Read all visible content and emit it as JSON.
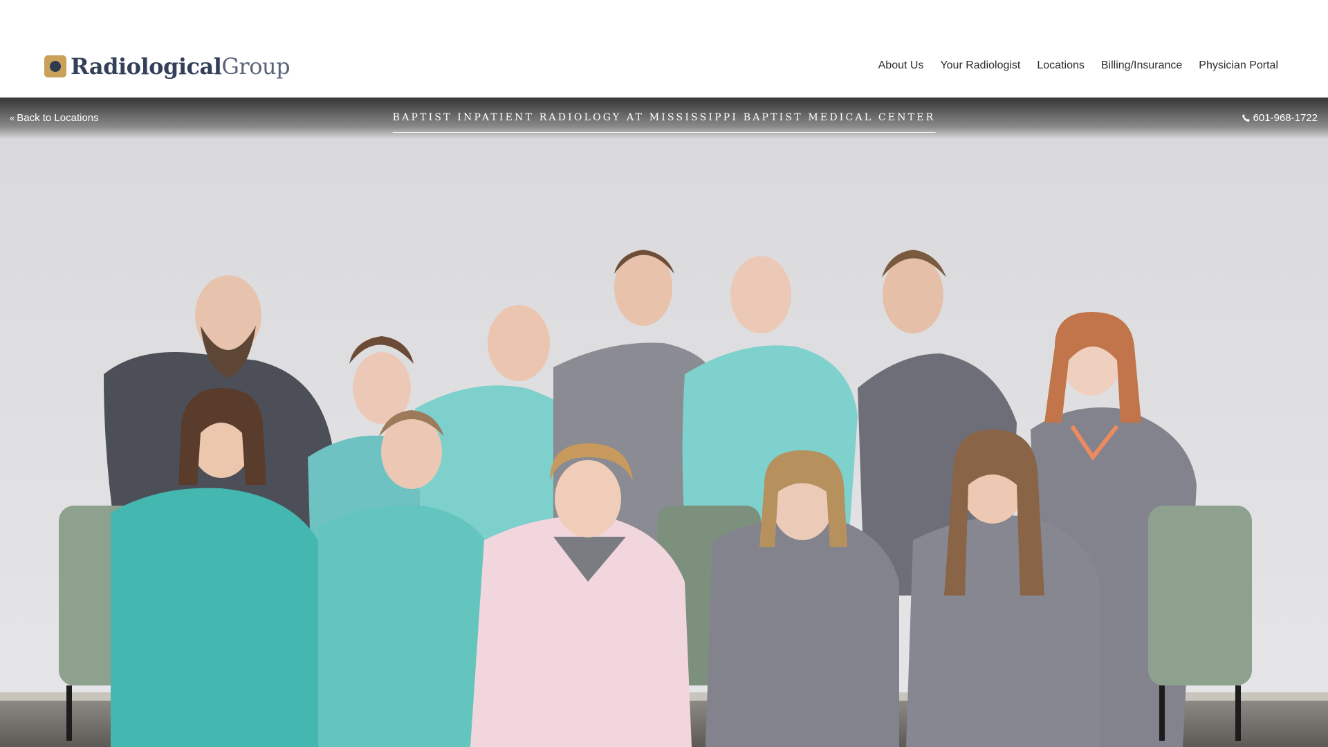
{
  "brand": {
    "name_strong": "Radiological",
    "name_light": "Group",
    "mark_icon": "logo-ring-icon",
    "colors": {
      "mark_gold": "#c9a15a",
      "mark_navy": "#2e3a4e",
      "text": "#34405a"
    }
  },
  "nav": {
    "items": [
      {
        "label": "About Us"
      },
      {
        "label": "Your Radiologist"
      },
      {
        "label": "Locations"
      },
      {
        "label": "Billing/Insurance"
      },
      {
        "label": "Physician Portal"
      }
    ]
  },
  "location_bar": {
    "back_label": "Back to Locations",
    "back_icon": "double-chevron-left-icon",
    "title": "BAPTIST INPATIENT RADIOLOGY AT MISSISSIPPI BAPTIST MEDICAL CENTER",
    "phone": "601-968-1722",
    "phone_icon": "phone-icon"
  },
  "hero": {
    "image": "team-group-photo",
    "colors": {
      "backdrop": "#dcdcdc",
      "teal_scrubs": "#3fb3ad",
      "gray_scrubs": "#7a7a82",
      "pink_jacket": "#f1d4dc"
    }
  }
}
